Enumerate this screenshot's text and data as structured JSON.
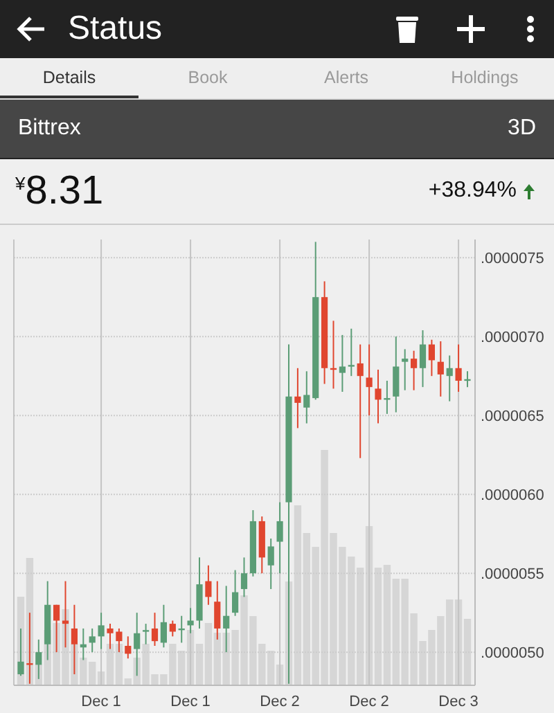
{
  "app_bar": {
    "title": "Status"
  },
  "tabs": [
    {
      "label": "Details",
      "selected": true
    },
    {
      "label": "Book",
      "selected": false
    },
    {
      "label": "Alerts",
      "selected": false
    },
    {
      "label": "Holdings",
      "selected": false
    }
  ],
  "market": {
    "exchange": "Bittrex",
    "range": "3D"
  },
  "price": {
    "currency": "¥",
    "value": "8.31",
    "change": "+38.94%"
  },
  "chart_data": {
    "type": "candlestick",
    "categories": [
      null,
      null,
      null,
      null,
      null,
      null,
      null,
      null,
      null,
      "Dec 1",
      null,
      null,
      null,
      null,
      null,
      null,
      null,
      null,
      null,
      "Dec 1",
      null,
      null,
      null,
      null,
      null,
      null,
      null,
      null,
      null,
      "Dec 2",
      null,
      null,
      null,
      null,
      null,
      null,
      null,
      null,
      null,
      "Dec 2",
      null,
      null,
      null,
      null,
      null,
      null,
      null,
      null,
      null,
      "Dec 3",
      null
    ],
    "ylim": [
      4.79e-06,
      7.615e-06
    ],
    "ohlc": [
      [
        4.86e-06,
        5.15e-06,
        4.85e-06,
        4.94e-06
      ],
      [
        4.93e-06,
        5.25e-06,
        4.8e-06,
        4.92e-06
      ],
      [
        4.92e-06,
        5.08e-06,
        4.83e-06,
        5e-06
      ],
      [
        5.05e-06,
        5.45e-06,
        4.95e-06,
        5.3e-06
      ],
      [
        5.3e-06,
        5.3e-06,
        5e-06,
        5.2e-06
      ],
      [
        5.2e-06,
        5.45e-06,
        5.03e-06,
        5.18e-06
      ],
      [
        5.15e-06,
        5.3e-06,
        4.86e-06,
        5.05e-06
      ],
      [
        5.03e-06,
        5.15e-06,
        4.95e-06,
        5.05e-06
      ],
      [
        5.06e-06,
        5.15e-06,
        5e-06,
        5.1e-06
      ],
      [
        5.1e-06,
        5.25e-06,
        5.02e-06,
        5.17e-06
      ],
      [
        5.15e-06,
        5.18e-06,
        5.02e-06,
        5.12e-06
      ],
      [
        5.13e-06,
        5.15e-06,
        5e-06,
        5.07e-06
      ],
      [
        5.04e-06,
        5.1e-06,
        4.96e-06,
        4.99e-06
      ],
      [
        5.02e-06,
        5.25e-06,
        4.85e-06,
        5.12e-06
      ],
      [
        5.13e-06,
        5.18e-06,
        5.05e-06,
        5.14e-06
      ],
      [
        5.15e-06,
        5.25e-06,
        5.04e-06,
        5.07e-06
      ],
      [
        5.06e-06,
        5.3e-06,
        5.03e-06,
        5.19e-06
      ],
      [
        5.18e-06,
        5.2e-06,
        5.1e-06,
        5.13e-06
      ],
      [
        5.14e-06,
        5.23e-06,
        5.06e-06,
        5.15e-06
      ],
      [
        5.17e-06,
        5.28e-06,
        5.12e-06,
        5.2e-06
      ],
      [
        5.2e-06,
        5.6e-06,
        5.15e-06,
        5.43e-06
      ],
      [
        5.45e-06,
        5.55e-06,
        5.3e-06,
        5.35e-06
      ],
      [
        5.32e-06,
        5.45e-06,
        5.08e-06,
        5.15e-06
      ],
      [
        5.15e-06,
        5.42e-06,
        5e-06,
        5.23e-06
      ],
      [
        5.25e-06,
        5.52e-06,
        5.23e-06,
        5.38e-06
      ],
      [
        5.4e-06,
        5.6e-06,
        5.35e-06,
        5.5e-06
      ],
      [
        5.5e-06,
        5.9e-06,
        5.48e-06,
        5.83e-06
      ],
      [
        5.83e-06,
        5.86e-06,
        5.5e-06,
        5.6e-06
      ],
      [
        5.55e-06,
        5.72e-06,
        5.4e-06,
        5.67e-06
      ],
      [
        5.7e-06,
        5.95e-06,
        5.5e-06,
        5.83e-06
      ],
      [
        5.95e-06,
        6.95e-06,
        4.8e-06,
        6.62e-06
      ],
      [
        6.62e-06,
        6.8e-06,
        6.42e-06,
        6.58e-06
      ],
      [
        6.55e-06,
        6.78e-06,
        6.45e-06,
        6.63e-06
      ],
      [
        6.61e-06,
        7.6e-06,
        6.6e-06,
        7.25e-06
      ],
      [
        7.25e-06,
        7.35e-06,
        6.7e-06,
        6.8e-06
      ],
      [
        6.8e-06,
        7.1e-06,
        6.67e-06,
        6.79e-06
      ],
      [
        6.77e-06,
        7.01e-06,
        6.65e-06,
        6.81e-06
      ],
      [
        6.81e-06,
        7.05e-06,
        6.75e-06,
        6.82e-06
      ],
      [
        6.83e-06,
        6.95e-06,
        6.23e-06,
        6.75e-06
      ],
      [
        6.74e-06,
        6.95e-06,
        6.5e-06,
        6.68e-06
      ],
      [
        6.67e-06,
        6.79e-06,
        6.45e-06,
        6.6e-06
      ],
      [
        6.6e-06,
        6.72e-06,
        6.51e-06,
        6.61e-06
      ],
      [
        6.62e-06,
        7e-06,
        6.52e-06,
        6.81e-06
      ],
      [
        6.84e-06,
        6.92e-06,
        6.66e-06,
        6.86e-06
      ],
      [
        6.86e-06,
        6.91e-06,
        6.66e-06,
        6.8e-06
      ],
      [
        6.8e-06,
        7.04e-06,
        6.68e-06,
        6.95e-06
      ],
      [
        6.95e-06,
        6.98e-06,
        6.75e-06,
        6.85e-06
      ],
      [
        6.84e-06,
        6.97e-06,
        6.62e-06,
        6.76e-06
      ],
      [
        6.75e-06,
        6.88e-06,
        6.59e-06,
        6.8e-06
      ],
      [
        6.8e-06,
        6.95e-06,
        6.65e-06,
        6.72e-06
      ],
      [
        6.73e-06,
        6.78e-06,
        6.68e-06,
        6.73e-06
      ]
    ],
    "grid": true,
    "yticks": [
      {
        "value": 7.5e-06,
        "label": ".0000075"
      },
      {
        "value": 7e-06,
        "label": ".0000070"
      },
      {
        "value": 6.5e-06,
        "label": ".0000065"
      },
      {
        "value": 6e-06,
        "label": ".0000060"
      },
      {
        "value": 5.5e-06,
        "label": ".0000055"
      },
      {
        "value": 5e-06,
        "label": ".0000050"
      }
    ]
  }
}
